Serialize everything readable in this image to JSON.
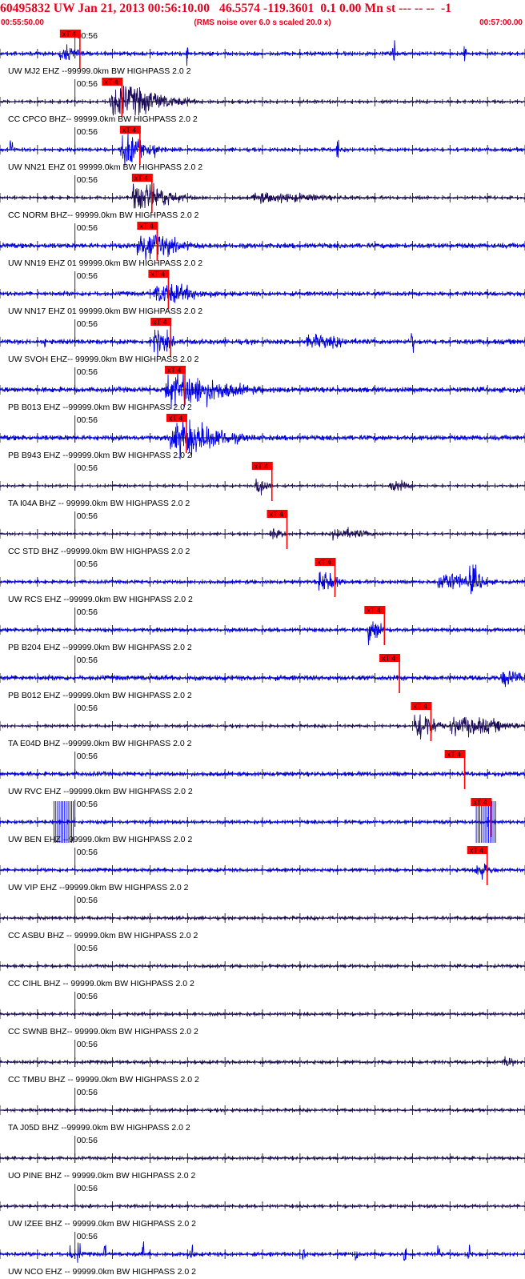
{
  "header": {
    "title": "60495832 UW Jan 21, 2013 00:56:10.00   46.5574 -119.3601  0.1 0.00 Mn st --- -- --  -1",
    "start_time": "00:55:50.00",
    "end_time": "00:57:00.00",
    "rms_note": "(RMS noise over 6.0 s scaled 20.0 x)"
  },
  "colors": {
    "header_red": "#e8001c",
    "pick_red": "#ff0000",
    "trace_blue": "#0000e6",
    "trace_dark": "#1c0a5a",
    "axis": "#000000"
  },
  "chart_data": {
    "type": "line",
    "title": "60495832 UW Jan 21, 2013 00:56:10.00   46.5574 -119.3601  0.1 0.00 Mn st --- -- --  -1",
    "x_range_seconds": [
      0,
      70
    ],
    "x_range_labels": [
      "00:55:50.00",
      "00:57:00.00"
    ],
    "minute_tick_label": "00:56",
    "minute_tick_second": 10,
    "pick_label": "xT 4",
    "traces": [
      {
        "label": "UW MJ2 EHZ --99999.0km BW  HIGHPASS  2.0  2",
        "color": "blue",
        "pick_s": 8.2,
        "event": [
          [
            8.5,
            2.0,
            0.8
          ]
        ],
        "noise": 0.22,
        "spikes": [
          25,
          52.5,
          62
        ]
      },
      {
        "label": "CC CPCO BHZ-- 99999.0km BW  HIGHPASS  2.0  2",
        "color": "dark",
        "pick_s": 13.8,
        "event": [
          [
            16.5,
            6.5,
            1.8
          ]
        ],
        "noise": 0.16,
        "spikes": []
      },
      {
        "label": "UW NN21 EHZ 01 99999.0km BW  HIGHPASS  2.0  2",
        "color": "blue",
        "pick_s": 16.2,
        "event": [
          [
            17.0,
            3.0,
            2.0
          ]
        ],
        "noise": 0.2,
        "spikes": [
          1.5,
          20.5,
          45
        ]
      },
      {
        "label": "CC NORM BHZ-- 99999.0km BW  HIGHPASS  2.0  2",
        "color": "dark",
        "pick_s": 17.8,
        "event": [
          [
            19.0,
            4.5,
            1.7
          ],
          [
            36,
            8,
            0.5
          ]
        ],
        "noise": 0.16,
        "spikes": []
      },
      {
        "label": "UW NN19 EHZ 01 99999.0km BW  HIGHPASS  2.0  2",
        "color": "blue",
        "pick_s": 18.5,
        "event": [
          [
            19.5,
            4.0,
            1.8
          ]
        ],
        "noise": 0.3,
        "spikes": []
      },
      {
        "label": "UW NN17 EHZ 01 99999.0km BW  HIGHPASS  2.0  2",
        "color": "blue",
        "pick_s": 20.0,
        "event": [
          [
            22.0,
            5.0,
            1.1
          ]
        ],
        "noise": 0.25,
        "spikes": []
      },
      {
        "label": "UW SVOH EHZ-- 99999.0km BW  HIGHPASS  2.0  2",
        "color": "blue",
        "pick_s": 20.3,
        "event": [
          [
            21.0,
            2.0,
            1.3
          ],
          [
            42,
            4,
            0.6
          ]
        ],
        "noise": 0.3,
        "spikes": [
          6,
          55
        ]
      },
      {
        "label": "PB B013 EHZ --99999.0km BW  HIGHPASS  2.0  2",
        "color": "blue",
        "pick_s": 22.2,
        "event": [
          [
            24.0,
            7.0,
            1.9
          ]
        ],
        "noise": 0.32,
        "spikes": []
      },
      {
        "label": "PB B943 EHZ --99999.0km BW  HIGHPASS  2.0  2",
        "color": "blue",
        "pick_s": 22.4,
        "event": [
          [
            24.5,
            6.0,
            2.0
          ]
        ],
        "noise": 0.3,
        "spikes": []
      },
      {
        "label": "TA I04A BHZ -- 99999.0km BW  HIGHPASS  2.0  2",
        "color": "dark",
        "pick_s": 33.8,
        "event": [
          [
            34.5,
            1.5,
            1.1
          ],
          [
            52.5,
            2.0,
            0.7
          ]
        ],
        "noise": 0.12,
        "spikes": []
      },
      {
        "label": "CC STD BHZ --99999.0km BW  HIGHPASS  2.0  2",
        "color": "dark",
        "pick_s": 35.8,
        "event": [
          [
            36.5,
            1.5,
            0.6
          ],
          [
            45.5,
            4,
            0.6
          ]
        ],
        "noise": 0.12,
        "spikes": []
      },
      {
        "label": "UW RCS EHZ --99999.0km BW  HIGHPASS  2.0  2",
        "color": "blue",
        "pick_s": 42.2,
        "event": [
          [
            43.0,
            2.0,
            1.3
          ],
          [
            59.5,
            4,
            1.1
          ],
          [
            63,
            1.5,
            1.3
          ]
        ],
        "noise": 0.2,
        "spikes": []
      },
      {
        "label": "PB B204 EHZ --99999.0km BW  HIGHPASS  2.0  2",
        "color": "blue",
        "pick_s": 48.8,
        "event": [
          [
            49.5,
            1.5,
            1.5
          ]
        ],
        "noise": 0.22,
        "spikes": []
      },
      {
        "label": "PB B012 EHZ --99999.0km BW  HIGHPASS  2.0  2",
        "color": "blue",
        "pick_s": 50.8,
        "event": [
          [
            67.5,
            2.5,
            0.8
          ]
        ],
        "noise": 0.3,
        "spikes": []
      },
      {
        "label": "TA E04D BHZ --99999.0km BW  HIGHPASS  2.0  2",
        "color": "dark",
        "pick_s": 55.0,
        "event": [
          [
            56.0,
            2.5,
            1.9
          ],
          [
            62,
            6,
            1.1
          ]
        ],
        "noise": 0.14,
        "spikes": []
      },
      {
        "label": "UW RVC EHZ --99999.0km BW  HIGHPASS  2.0  2",
        "color": "blue",
        "pick_s": 59.5,
        "event": [],
        "noise": 0.25,
        "spikes": []
      },
      {
        "label": "UW BEN EHZ --99999.0km BW  HIGHPASS  2.0  2",
        "color": "blue",
        "pick_s": 63.0,
        "event": [],
        "noise": 0.2,
        "spikes": [],
        "clipped": [
          [
            7.2,
            9.8
          ],
          [
            63.5,
            66.3
          ]
        ]
      },
      {
        "label": "UW VIP EHZ --99999.0km BW  HIGHPASS  2.0  2",
        "color": "blue",
        "pick_s": 62.5,
        "event": [
          [
            63.8,
            1.5,
            1.1
          ]
        ],
        "noise": 0.2,
        "spikes": []
      },
      {
        "label": "CC ASBU BHZ -- 99999.0km BW  HIGHPASS  2.0  2",
        "color": "dark",
        "pick_s": null,
        "event": [],
        "noise": 0.18,
        "spikes": []
      },
      {
        "label": "CC CIHL BHZ -- 99999.0km BW  HIGHPASS  2.0  2",
        "color": "dark",
        "pick_s": null,
        "event": [],
        "noise": 0.16,
        "spikes": []
      },
      {
        "label": "CC SWNB BHZ-- 99999.0km BW  HIGHPASS  2.0  2",
        "color": "dark",
        "pick_s": null,
        "event": [],
        "noise": 0.16,
        "spikes": []
      },
      {
        "label": "CC TMBU BHZ -- 99999.0km BW  HIGHPASS  2.0  2",
        "color": "dark",
        "pick_s": null,
        "event": [
          [
            67.5,
            1.0,
            0.7
          ]
        ],
        "noise": 0.18,
        "spikes": []
      },
      {
        "label": "TA J05D BHZ --99999.0km BW  HIGHPASS  2.0  2",
        "color": "dark",
        "pick_s": null,
        "event": [],
        "noise": 0.16,
        "spikes": []
      },
      {
        "label": "UO PINE BHZ -- 99999.0km BW  HIGHPASS  2.0  2",
        "color": "dark",
        "pick_s": null,
        "event": [],
        "noise": 0.16,
        "spikes": []
      },
      {
        "label": "UW IZEE BHZ -- 99999.0km BW  HIGHPASS  2.0  2",
        "color": "dark",
        "pick_s": null,
        "event": [],
        "noise": 0.16,
        "spikes": []
      },
      {
        "label": "UW NCO EHZ -- 99999.0km BW  HIGHPASS  2.0  2",
        "color": "blue",
        "pick_s": null,
        "event": [],
        "noise": 0.22,
        "spikes": [
          9.5,
          10.5,
          14,
          19,
          25.5,
          40.5,
          47.5,
          54,
          58.5,
          62.5
        ]
      }
    ]
  }
}
